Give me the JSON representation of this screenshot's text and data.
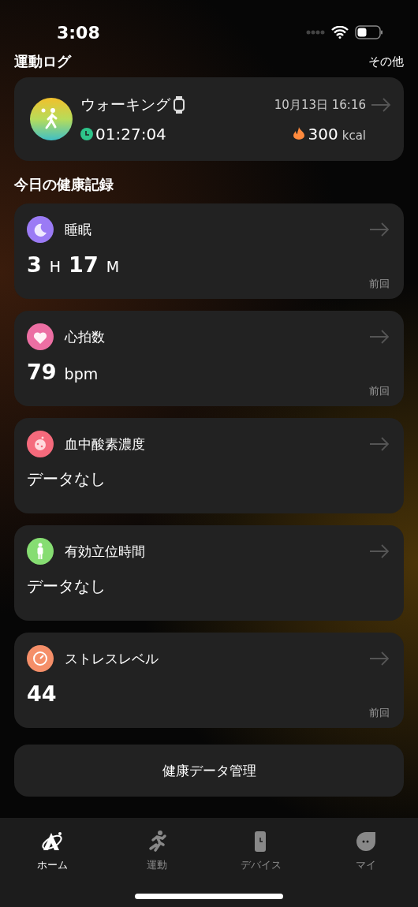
{
  "status_bar": {
    "time": "3:08"
  },
  "exercise_log": {
    "title": "運動ログ",
    "more": "その他",
    "entry": {
      "name": "ウォーキング",
      "datetime": "10月13日 16:16",
      "duration": "01:27:04",
      "calories": "300",
      "calories_unit": "kcal"
    }
  },
  "health_section": {
    "title": "今日の健康記録",
    "cards": [
      {
        "title": "睡眠",
        "color": "#9b7bf5",
        "kind": "reading",
        "segments": [
          {
            "text": "3",
            "kind": "number"
          },
          {
            "text": "H",
            "kind": "unit"
          },
          {
            "text": "17",
            "kind": "number"
          },
          {
            "text": "M",
            "kind": "unit"
          }
        ],
        "previous": "前回"
      },
      {
        "title": "心拍数",
        "color": "#ec6fa3",
        "kind": "reading",
        "segments": [
          {
            "text": "79",
            "kind": "number"
          },
          {
            "text": "bpm",
            "kind": "unit"
          }
        ],
        "previous": "前回"
      },
      {
        "title": "血中酸素濃度",
        "color": "#f56a7c",
        "kind": "empty",
        "empty_text": "データなし"
      },
      {
        "title": "有効立位時間",
        "color": "#86dd72",
        "kind": "empty",
        "empty_text": "データなし"
      },
      {
        "title": "ストレスレベル",
        "color": "#f58f69",
        "kind": "reading",
        "segments": [
          {
            "text": "44",
            "kind": "number"
          }
        ],
        "previous": "前回"
      }
    ]
  },
  "manage_button": "健康データ管理",
  "tab_bar": [
    {
      "label": "ホーム",
      "selected": true
    },
    {
      "label": "運動",
      "selected": false
    },
    {
      "label": "デバイス",
      "selected": false
    },
    {
      "label": "マイ",
      "selected": false
    }
  ]
}
